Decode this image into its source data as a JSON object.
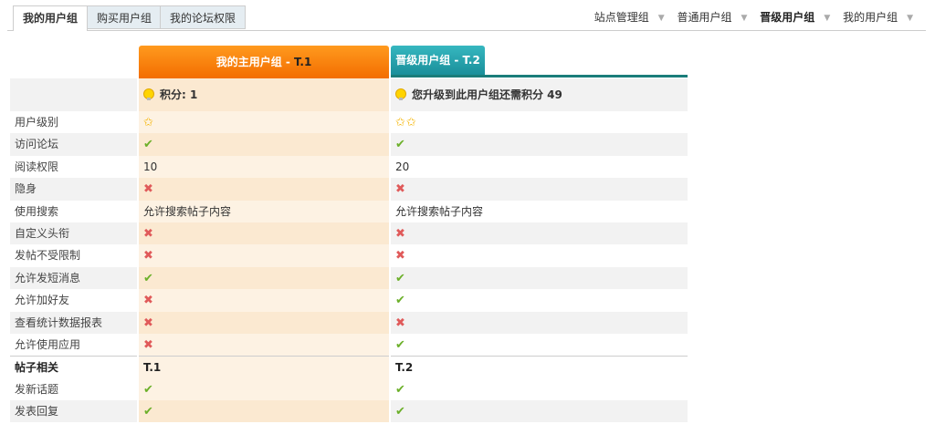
{
  "tabs": [
    "我的用户组",
    "购买用户组",
    "我的论坛权限"
  ],
  "group_nav": [
    "站点管理组",
    "普通用户组",
    "晋级用户组",
    "我的用户组"
  ],
  "group_nav_arrow": "▼",
  "columns": {
    "mine": {
      "title": "我的主用户组 - ",
      "level": "T.1"
    },
    "next": {
      "title": "晋级用户组 - T.2"
    }
  },
  "points_row": {
    "mine": "积分: 1",
    "next": "您升级到此用户组还需积分 49"
  },
  "symbols": {
    "yes": "✔",
    "no": "✖",
    "star": "✩"
  },
  "rows": [
    {
      "label": "用户级别",
      "mine": "✩",
      "next": "✩✩",
      "kind": "star"
    },
    {
      "label": "访问论坛",
      "mine": "✔",
      "next": "✔",
      "kind": "mark"
    },
    {
      "label": "阅读权限",
      "mine": "10",
      "next": "20",
      "kind": "text"
    },
    {
      "label": "隐身",
      "mine": "✖",
      "next": "✖",
      "kind": "mark"
    },
    {
      "label": "使用搜索",
      "mine": "允许搜索帖子内容",
      "next": "允许搜索帖子内容",
      "kind": "text"
    },
    {
      "label": "自定义头衔",
      "mine": "✖",
      "next": "✖",
      "kind": "mark"
    },
    {
      "label": "发帖不受限制",
      "mine": "✖",
      "next": "✖",
      "kind": "mark"
    },
    {
      "label": "允许发短消息",
      "mine": "✔",
      "next": "✔",
      "kind": "mark"
    },
    {
      "label": "允许加好友",
      "mine": "✖",
      "next": "✔",
      "kind": "mark"
    },
    {
      "label": "查看统计数据报表",
      "mine": "✖",
      "next": "✖",
      "kind": "mark"
    },
    {
      "label": "允许使用应用",
      "mine": "✖",
      "next": "✔",
      "kind": "mark"
    }
  ],
  "section": {
    "label": "帖子相关",
    "mine": "T.1",
    "next": "T.2"
  },
  "post_rows": [
    {
      "label": "发新话题",
      "mine": "✔",
      "next": "✔",
      "kind": "mark"
    },
    {
      "label": "发表回复",
      "mine": "✔",
      "next": "✔",
      "kind": "mark"
    }
  ],
  "colors": {
    "mine_header": "#f36d00",
    "next_header": "#1a8f9a",
    "yes": "#6cb02a",
    "no": "#e05a5a"
  }
}
